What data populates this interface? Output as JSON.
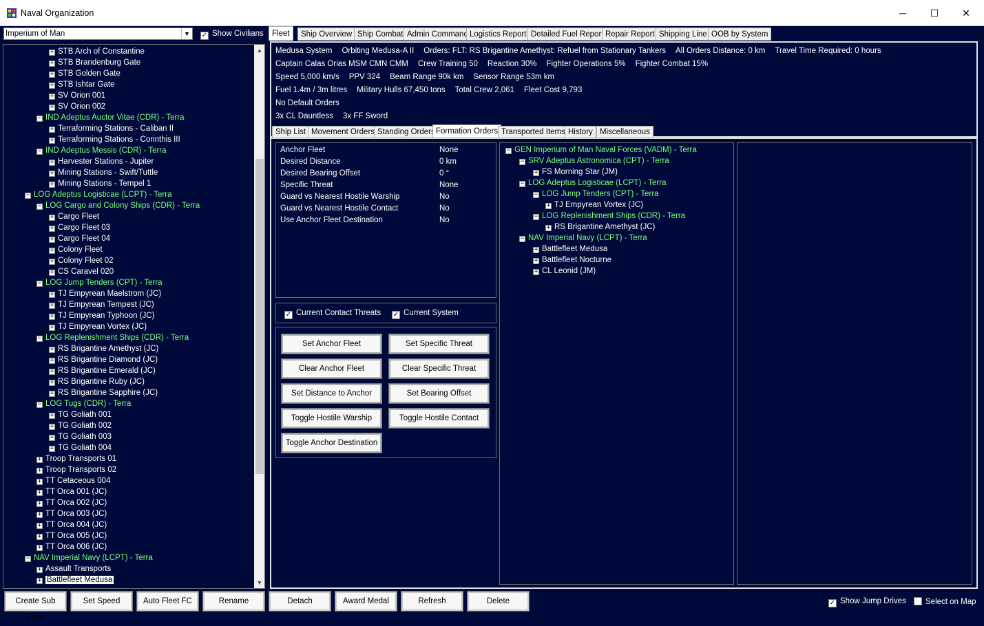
{
  "window": {
    "title": "Naval Organization",
    "minimize": "─",
    "maximize": "☐",
    "close": "✕"
  },
  "empire_select": {
    "value": "Imperium of Man"
  },
  "show_civilians": {
    "label": "Show Civilians",
    "checked": true
  },
  "left_tree": [
    {
      "text": "STB Arch of Constantine",
      "level": 3,
      "color": "w",
      "exp": "+"
    },
    {
      "text": "STB Brandenburg Gate",
      "level": 3,
      "color": "w",
      "exp": "+"
    },
    {
      "text": "STB Golden Gate",
      "level": 3,
      "color": "w",
      "exp": "+"
    },
    {
      "text": "STB Ishtar Gate",
      "level": 3,
      "color": "w",
      "exp": "+"
    },
    {
      "text": "SV Orion 001",
      "level": 3,
      "color": "w",
      "exp": "+"
    },
    {
      "text": "SV Orion 002",
      "level": 3,
      "color": "w",
      "exp": "+"
    },
    {
      "text": "IND Adeptus Auctor Vitae  (CDR)  -  Terra",
      "level": 2,
      "color": "g",
      "exp": "-"
    },
    {
      "text": "Terraforming Stations - Caliban II",
      "level": 3,
      "color": "w",
      "exp": "+"
    },
    {
      "text": "Terraforming Stations - Corinthis III",
      "level": 3,
      "color": "w",
      "exp": "+"
    },
    {
      "text": "IND Adeptus Messis  (CDR)  -  Terra",
      "level": 2,
      "color": "g",
      "exp": "-"
    },
    {
      "text": "Harvester Stations - Jupiter",
      "level": 3,
      "color": "w",
      "exp": "+"
    },
    {
      "text": "Mining Stations - Swift/Tuttle",
      "level": 3,
      "color": "w",
      "exp": "+"
    },
    {
      "text": "Mining Stations - Tempel 1",
      "level": 3,
      "color": "w",
      "exp": "+"
    },
    {
      "text": "LOG Adeptus Logisticae  (LCPT)  -  Terra",
      "level": 1,
      "color": "g",
      "exp": "-"
    },
    {
      "text": "LOG Cargo and Colony Ships  (CDR)  -  Terra",
      "level": 2,
      "color": "g",
      "exp": "-"
    },
    {
      "text": "Cargo Fleet",
      "level": 3,
      "color": "w",
      "exp": "+"
    },
    {
      "text": "Cargo Fleet 03",
      "level": 3,
      "color": "w",
      "exp": "+"
    },
    {
      "text": "Cargo Fleet 04",
      "level": 3,
      "color": "w",
      "exp": "+"
    },
    {
      "text": "Colony Fleet",
      "level": 3,
      "color": "w",
      "exp": "+"
    },
    {
      "text": "Colony Fleet 02",
      "level": 3,
      "color": "w",
      "exp": "+"
    },
    {
      "text": "CS Caravel 020",
      "level": 3,
      "color": "w",
      "exp": "+"
    },
    {
      "text": "LOG Jump Tenders  (CPT)  -  Terra",
      "level": 2,
      "color": "g",
      "exp": "-"
    },
    {
      "text": "TJ Empyrean Maelstrom  (JC)",
      "level": 3,
      "color": "w",
      "exp": "+"
    },
    {
      "text": "TJ Empyrean Tempest  (JC)",
      "level": 3,
      "color": "w",
      "exp": "+"
    },
    {
      "text": "TJ Empyrean Typhoon  (JC)",
      "level": 3,
      "color": "w",
      "exp": "+"
    },
    {
      "text": "TJ Empyrean Vortex  (JC)",
      "level": 3,
      "color": "w",
      "exp": "+"
    },
    {
      "text": "LOG Replenishment Ships  (CDR)  -  Terra",
      "level": 2,
      "color": "g",
      "exp": "-"
    },
    {
      "text": "RS Brigantine Amethyst  (JC)",
      "level": 3,
      "color": "w",
      "exp": "+"
    },
    {
      "text": "RS Brigantine Diamond  (JC)",
      "level": 3,
      "color": "w",
      "exp": "+"
    },
    {
      "text": "RS Brigantine Emerald  (JC)",
      "level": 3,
      "color": "w",
      "exp": "+"
    },
    {
      "text": "RS Brigantine Ruby  (JC)",
      "level": 3,
      "color": "w",
      "exp": "+"
    },
    {
      "text": "RS Brigantine Sapphire  (JC)",
      "level": 3,
      "color": "w",
      "exp": "+"
    },
    {
      "text": "LOG Tugs  (CDR)  -  Terra",
      "level": 2,
      "color": "g",
      "exp": "-"
    },
    {
      "text": "TG Goliath 001",
      "level": 3,
      "color": "w",
      "exp": "+"
    },
    {
      "text": "TG Goliath 002",
      "level": 3,
      "color": "w",
      "exp": "+"
    },
    {
      "text": "TG Goliath 003",
      "level": 3,
      "color": "w",
      "exp": "+"
    },
    {
      "text": "TG Goliath 004",
      "level": 3,
      "color": "w",
      "exp": "+"
    },
    {
      "text": "Troop Transports 01",
      "level": 2,
      "color": "w",
      "exp": "+"
    },
    {
      "text": "Troop Transports 02",
      "level": 2,
      "color": "w",
      "exp": "+"
    },
    {
      "text": "TT Cetaceous 004",
      "level": 2,
      "color": "w",
      "exp": "+"
    },
    {
      "text": "TT Orca 001  (JC)",
      "level": 2,
      "color": "w",
      "exp": "+"
    },
    {
      "text": "TT Orca 002  (JC)",
      "level": 2,
      "color": "w",
      "exp": "+"
    },
    {
      "text": "TT Orca 003  (JC)",
      "level": 2,
      "color": "w",
      "exp": "+"
    },
    {
      "text": "TT Orca 004  (JC)",
      "level": 2,
      "color": "w",
      "exp": "+"
    },
    {
      "text": "TT Orca 005  (JC)",
      "level": 2,
      "color": "w",
      "exp": "+"
    },
    {
      "text": "TT Orca 006  (JC)",
      "level": 2,
      "color": "w",
      "exp": "+"
    },
    {
      "text": "NAV Imperial Navy  (LCPT)  -  Terra",
      "level": 1,
      "color": "g",
      "exp": "-"
    },
    {
      "text": "Assault Transports",
      "level": 2,
      "color": "w",
      "exp": "+"
    },
    {
      "text": "Battlefleet Medusa",
      "level": 2,
      "color": "w",
      "exp": "+",
      "selected": true
    }
  ],
  "main_tabs": [
    "Fleet",
    "Ship Overview",
    "Ship Combat",
    "Admin Command",
    "Logistics Report",
    "Detailed Fuel Report",
    "Repair Report",
    "Shipping Line",
    "OOB by System"
  ],
  "fleet_info": {
    "line1": [
      "Medusa System",
      "Orbiting Medusa-A II",
      "Orders: FLT: RS Brigantine Amethyst: Refuel from Stationary Tankers",
      "All Orders Distance: 0 km",
      "Travel Time Required: 0 hours"
    ],
    "line2": [
      "Captain Calas Orias MSM CMN CMM",
      "Crew Training 50",
      "Reaction 30%",
      "Fighter Operations 5%",
      "Fighter Combat 15%"
    ],
    "line3": [
      "Speed 5,000 km/s",
      "PPV 324",
      "Beam Range 90k  km",
      "Sensor Range 53m  km"
    ],
    "line4": [
      "Fuel 1.4m / 3m litres",
      "Military Hulls 67,450 tons",
      "Total Crew 2,061",
      "Fleet Cost 9,793"
    ],
    "line5": [
      "No Default Orders"
    ],
    "line6": [
      "3x CL Dauntless",
      "3x FF Sword"
    ]
  },
  "sub_tabs": [
    "Ship List",
    "Movement Orders",
    "Standing Orders",
    "Formation Orders",
    "Transported Items",
    "History",
    "Miscellaneous"
  ],
  "formation_orders": [
    {
      "label": "Anchor Fleet",
      "value": "None"
    },
    {
      "label": "Desired Distance",
      "value": "0 km"
    },
    {
      "label": "Desired Bearing Offset",
      "value": "0 °"
    },
    {
      "label": "Specific Threat",
      "value": "None"
    },
    {
      "label": "Guard vs Nearest Hostile Warship",
      "value": "No"
    },
    {
      "label": "Guard vs Nearest Hostile Contact",
      "value": "No"
    },
    {
      "label": "Use Anchor Fleet Destination",
      "value": "No"
    }
  ],
  "threat_checks": {
    "contact": "Current Contact Threats",
    "system": "Current System"
  },
  "formation_buttons": [
    "Set Anchor Fleet",
    "Set Specific Threat",
    "Clear Anchor Fleet",
    "Clear Specific Threat",
    "Set Distance to Anchor",
    "Set Bearing Offset",
    "Toggle Hostile Warship",
    "Toggle Hostile Contact",
    "Toggle Anchor Destination"
  ],
  "right_tree": [
    {
      "text": "GEN Imperium of Man Naval Forces  (VADM)  -  Terra",
      "level": 0,
      "color": "g",
      "exp": "-"
    },
    {
      "text": "SRV Adeptus Astronomica  (CPT)  -  Terra",
      "level": 1,
      "color": "g",
      "exp": "-"
    },
    {
      "text": "FS Morning Star  (JM)",
      "level": 2,
      "color": "w",
      "exp": "+"
    },
    {
      "text": "LOG Adeptus Logisticae  (LCPT)  -  Terra",
      "level": 1,
      "color": "g",
      "exp": "-"
    },
    {
      "text": "LOG Jump Tenders  (CPT)  -  Terra",
      "level": 2,
      "color": "g",
      "exp": "-"
    },
    {
      "text": "TJ Empyrean Vortex  (JC)",
      "level": 3,
      "color": "w",
      "exp": "+"
    },
    {
      "text": "LOG Replenishment Ships  (CDR)  -  Terra",
      "level": 2,
      "color": "g",
      "exp": "-"
    },
    {
      "text": "RS Brigantine Amethyst  (JC)",
      "level": 3,
      "color": "w",
      "exp": "+"
    },
    {
      "text": "NAV Imperial Navy  (LCPT)  -  Terra",
      "level": 1,
      "color": "g",
      "exp": "-"
    },
    {
      "text": "Battlefleet Medusa",
      "level": 2,
      "color": "w",
      "exp": "+"
    },
    {
      "text": "Battlefleet Nocturne",
      "level": 2,
      "color": "w",
      "exp": "+"
    },
    {
      "text": "CL Leonid  (JM)",
      "level": 2,
      "color": "w",
      "exp": "+"
    }
  ],
  "bottom_buttons": [
    "Create Sub Fleet",
    "Set Speed",
    "Auto Fleet FC",
    "Rename",
    "Detach",
    "Award Medal",
    "Refresh",
    "Delete"
  ],
  "bottom_checks": {
    "jump": "Show Jump Drives",
    "map": "Select on Map"
  },
  "colors": {
    "background": "#000a3a",
    "green_text": "#7cff7c"
  }
}
